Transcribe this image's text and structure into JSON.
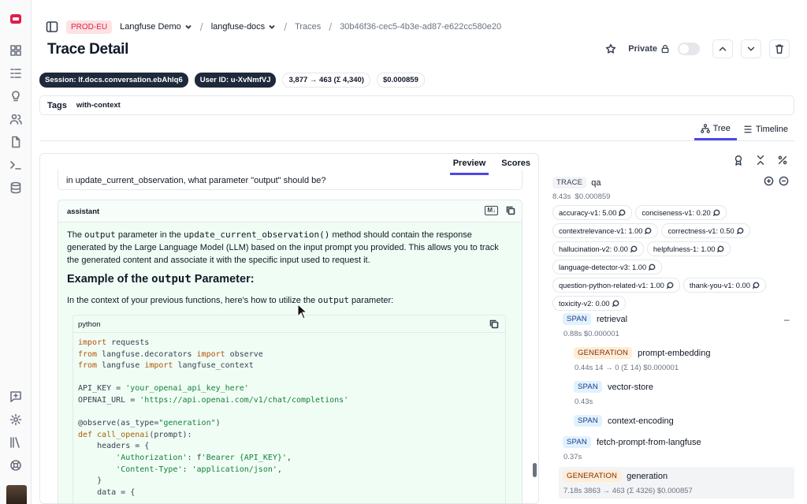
{
  "breadcrumb": {
    "env": "PROD-EU",
    "org": "Langfuse Demo",
    "project": "langfuse-docs",
    "section": "Traces",
    "trace_id": "30b46f36-cec5-4b3e-ad87-e622cc580e20"
  },
  "page_title": "Trace Detail",
  "header_actions": {
    "private_label": "Private"
  },
  "pills": {
    "session": "Session: lf.docs.conversation.ebAhlq6",
    "user": "User ID: u-XvNmfVJ",
    "tokens": "3,877 → 463 (Σ 4,340)",
    "cost": "$0.000859"
  },
  "tags": {
    "label": "Tags",
    "items": [
      "with-context"
    ]
  },
  "view_tabs": {
    "tree": "Tree",
    "timeline": "Timeline",
    "active": "Tree"
  },
  "left_panel": {
    "tabs": {
      "preview": "Preview",
      "scores": "Scores"
    },
    "question_tail": "in update_current_observation, what parameter \"output\" should be?",
    "assistant_label": "assistant",
    "para1_a": "The ",
    "para1_code1": "output",
    "para1_b": " parameter in the ",
    "para1_code2": "update_current_observation()",
    "para1_c": " method should contain the response generated by the Large Language Model (LLM) based on the input prompt you provided. This allows you to track the generated content and associate it with the specific input used to request it.",
    "heading_a": "Example of the ",
    "heading_code": "output",
    "heading_b": " Parameter:",
    "para2_a": "In the context of your previous functions, here's how to utilize the ",
    "para2_code": "output",
    "para2_b": " parameter:",
    "code_lang": "python",
    "code_lines": [
      "import requests",
      "from langfuse.decorators import observe",
      "from langfuse import langfuse_context",
      "",
      "API_KEY = 'your_openai_api_key_here'",
      "OPENAI_URL = 'https://api.openai.com/v1/chat/completions'",
      "",
      "@observe(as_type=\"generation\")",
      "def call_openai(prompt):",
      "    headers = {",
      "        'Authorization': f'Bearer {API_KEY}',",
      "        'Content-Type': 'application/json',",
      "    }",
      "    data = {"
    ]
  },
  "tree": {
    "trace": {
      "type": "TRACE",
      "name": "qa",
      "latency": "8.43s",
      "cost": "$0.000859"
    },
    "scores": [
      "accuracy-v1: 5.00",
      "conciseness-v1: 0.20",
      "contextrelevance-v1: 1.00",
      "correctness-v1: 0.50",
      "hallucination-v2: 0.00",
      "helpfulness-1: 1.00",
      "language-detector-v3: 1.00",
      "question-python-related-v1: 1.00",
      "thank-you-v1: 0.00",
      "toxicity-v2: 0.00"
    ],
    "nodes": [
      {
        "type": "SPAN",
        "name": "retrieval",
        "meta": "0.88s  $0.000001"
      },
      {
        "type": "GENERATION",
        "name": "prompt-embedding",
        "meta": "0.44s  14 → 0 (Σ 14)  $0.000001"
      },
      {
        "type": "SPAN",
        "name": "vector-store",
        "meta": "0.43s"
      },
      {
        "type": "SPAN",
        "name": "context-encoding",
        "meta": ""
      },
      {
        "type": "SPAN",
        "name": "fetch-prompt-from-langfuse",
        "meta": "0.37s"
      },
      {
        "type": "GENERATION",
        "name": "generation",
        "meta": "7.18s  3863 → 463 (Σ 4326)  $0.000857"
      }
    ]
  }
}
